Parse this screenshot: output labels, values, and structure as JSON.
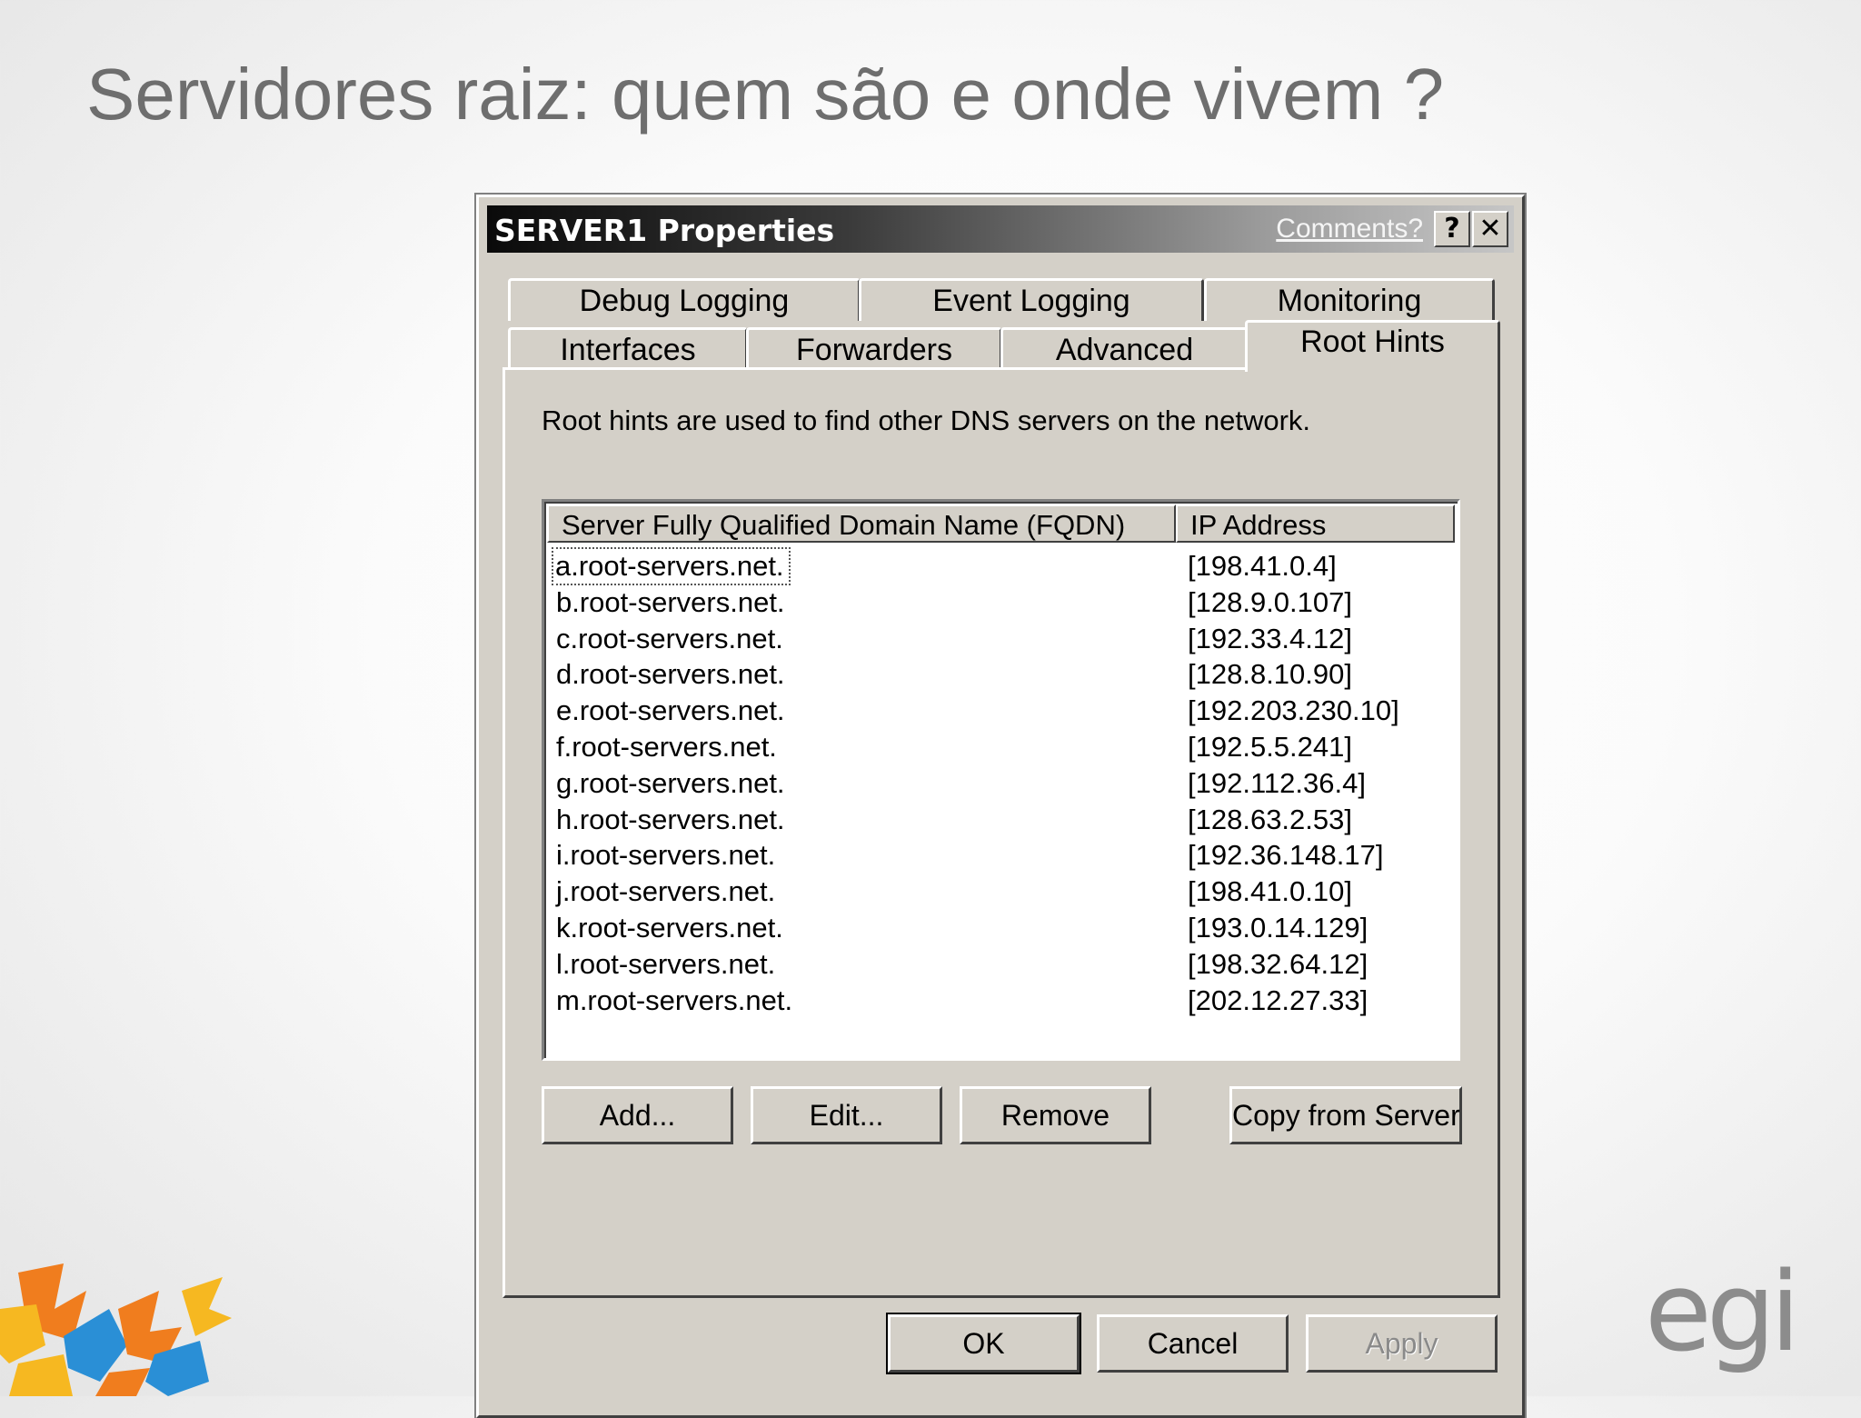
{
  "slide": {
    "title": "Servidores raiz: quem são e onde vivem ?",
    "brand_text": "egi"
  },
  "dialog": {
    "title": "SERVER1 Properties",
    "comments_link": "Comments?",
    "help_label": "?",
    "close_label": "✕",
    "tabs_top": [
      {
        "label": "Debug Logging"
      },
      {
        "label": "Event Logging"
      },
      {
        "label": "Monitoring"
      }
    ],
    "tabs_bottom": [
      {
        "label": "Interfaces"
      },
      {
        "label": "Forwarders"
      },
      {
        "label": "Advanced"
      },
      {
        "label": "Root Hints",
        "active": true
      }
    ],
    "description": "Root hints are used to find other DNS servers on the network.",
    "columns": [
      "Server Fully Qualified Domain Name (FQDN)",
      "IP Address"
    ],
    "rows": [
      {
        "fqdn": "a.root-servers.net.",
        "ip": "[198.41.0.4]"
      },
      {
        "fqdn": "b.root-servers.net.",
        "ip": "[128.9.0.107]"
      },
      {
        "fqdn": "c.root-servers.net.",
        "ip": "[192.33.4.12]"
      },
      {
        "fqdn": "d.root-servers.net.",
        "ip": "[128.8.10.90]"
      },
      {
        "fqdn": "e.root-servers.net.",
        "ip": "[192.203.230.10]"
      },
      {
        "fqdn": "f.root-servers.net.",
        "ip": "[192.5.5.241]"
      },
      {
        "fqdn": "g.root-servers.net.",
        "ip": "[192.112.36.4]"
      },
      {
        "fqdn": "h.root-servers.net.",
        "ip": "[128.63.2.53]"
      },
      {
        "fqdn": "i.root-servers.net.",
        "ip": "[192.36.148.17]"
      },
      {
        "fqdn": "j.root-servers.net.",
        "ip": "[198.41.0.10]"
      },
      {
        "fqdn": "k.root-servers.net.",
        "ip": "[193.0.14.129]"
      },
      {
        "fqdn": "l.root-servers.net.",
        "ip": "[198.32.64.12]"
      },
      {
        "fqdn": "m.root-servers.net.",
        "ip": "[202.12.27.33]"
      }
    ],
    "actions": {
      "add": "Add...",
      "edit": "Edit...",
      "remove": "Remove",
      "copy_from_server": "Copy from Server"
    },
    "footer": {
      "ok": "OK",
      "cancel": "Cancel",
      "apply": "Apply"
    }
  },
  "colors": {
    "dialog_face": "#d4d0c8",
    "title_text": "#6e6e6e",
    "brand_gray": "#8c8c8c",
    "logo_orange": "#f07d1e",
    "logo_yellow": "#f6b821",
    "logo_blue": "#2a8fd6"
  }
}
